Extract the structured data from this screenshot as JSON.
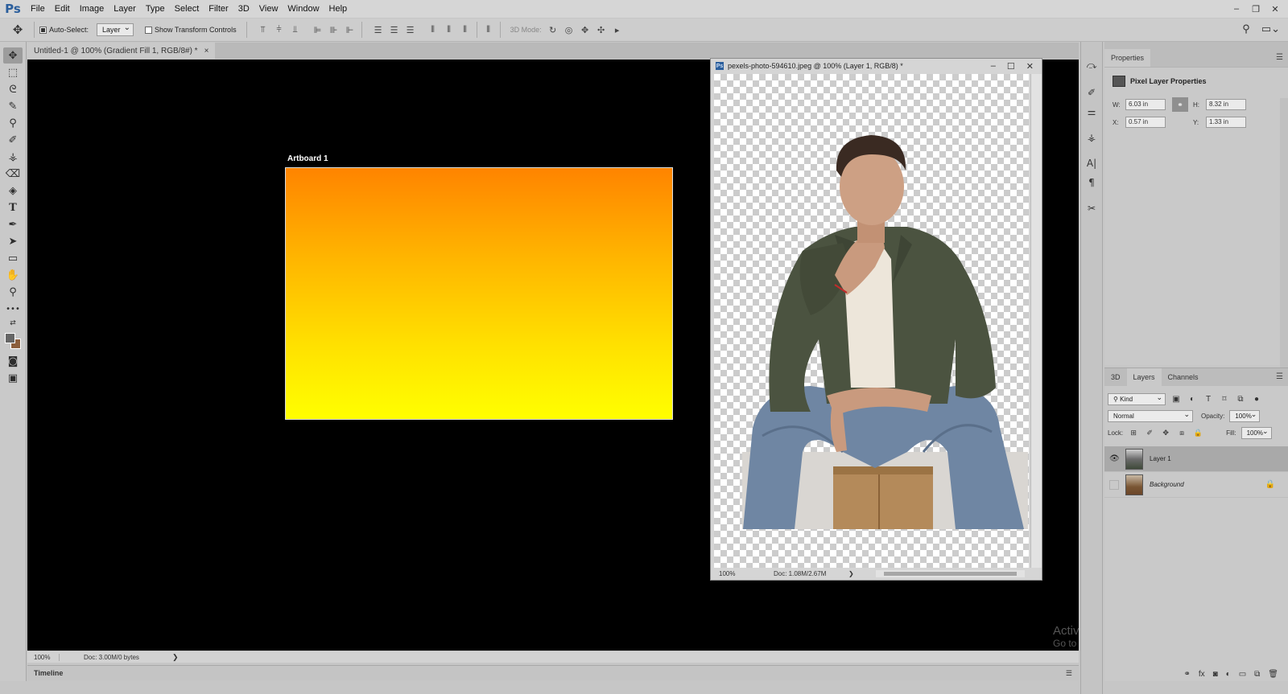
{
  "app": {
    "logo": "Ps",
    "menu": [
      "File",
      "Edit",
      "Image",
      "Layer",
      "Type",
      "Select",
      "Filter",
      "3D",
      "View",
      "Window",
      "Help"
    ],
    "window_controls": {
      "minimize": "–",
      "restore": "❐",
      "close": "✕"
    }
  },
  "options_bar": {
    "auto_select_label": "Auto-Select:",
    "auto_select_checked": true,
    "auto_select_target": "Layer",
    "show_transform_label": "Show Transform Controls",
    "show_transform_checked": false,
    "mode_3d_label": "3D Mode:",
    "icons": [
      "move-icon",
      "align-icon",
      "distribute-icon",
      "orbit-icon",
      "search-icon",
      "workspace-icon"
    ]
  },
  "tools": [
    {
      "name": "move-tool",
      "glyph": "✥",
      "active": true
    },
    {
      "name": "marquee-tool",
      "glyph": "⬚"
    },
    {
      "name": "lasso-tool",
      "glyph": "ᘓ"
    },
    {
      "name": "quick-select-tool",
      "glyph": "✎"
    },
    {
      "name": "eyedropper-tool",
      "glyph": "⚲"
    },
    {
      "name": "brush-tool",
      "glyph": "✐"
    },
    {
      "name": "stamp-tool",
      "glyph": "⚶"
    },
    {
      "name": "eraser-tool",
      "glyph": "⌫"
    },
    {
      "name": "bucket-tool",
      "glyph": "◈"
    },
    {
      "name": "type-tool",
      "glyph": "T"
    },
    {
      "name": "pen-tool",
      "glyph": "✒"
    },
    {
      "name": "path-select-tool",
      "glyph": "➤"
    },
    {
      "name": "rectangle-tool",
      "glyph": "▭"
    },
    {
      "name": "hand-tool",
      "glyph": "✋"
    },
    {
      "name": "zoom-tool",
      "glyph": "⚲"
    },
    {
      "name": "more-tools",
      "glyph": "•••"
    }
  ],
  "colors": {
    "foreground": "#666666",
    "background": "#8b5e3c",
    "artboard_top": "#ff8400",
    "artboard_bottom": "#ffff00"
  },
  "document": {
    "tab_title": "Untitled-1 @ 100% (Gradient Fill 1, RGB/8#) *",
    "tab_close": "×",
    "artboard_label": "Artboard 1",
    "status_zoom": "100%",
    "status_doc": "Doc: 3.00M/0 bytes",
    "status_arrow": "❯"
  },
  "floating_window": {
    "title": "pexels-photo-594610.jpeg @ 100% (Layer 1, RGB/8) *",
    "zoom": "100%",
    "doc": "Doc: 1.08M/2.67M",
    "arrow": "❯"
  },
  "timeline_label": "Timeline",
  "watermark": {
    "line1": "Activate Windows",
    "line2": "Go to Settings to activate Windows."
  },
  "properties": {
    "tab": "Properties",
    "header": "Pixel Layer Properties",
    "w_label": "W:",
    "w_value": "6.03 in",
    "h_label": "H:",
    "h_value": "8.32 in",
    "x_label": "X:",
    "x_value": "0.57 in",
    "y_label": "Y:",
    "y_value": "1.33 in"
  },
  "layers_panel": {
    "tabs": [
      "3D",
      "Layers",
      "Channels"
    ],
    "selected_tab": "Layers",
    "filter_kind": "Kind",
    "blend_mode": "Normal",
    "opacity_label": "Opacity:",
    "opacity_value": "100%",
    "lock_label": "Lock:",
    "fill_label": "Fill:",
    "fill_value": "100%",
    "layers": [
      {
        "name": "Layer 1",
        "visible": true,
        "selected": true,
        "italic": false,
        "locked": false
      },
      {
        "name": "Background",
        "visible": false,
        "selected": false,
        "italic": true,
        "locked": true
      }
    ]
  }
}
